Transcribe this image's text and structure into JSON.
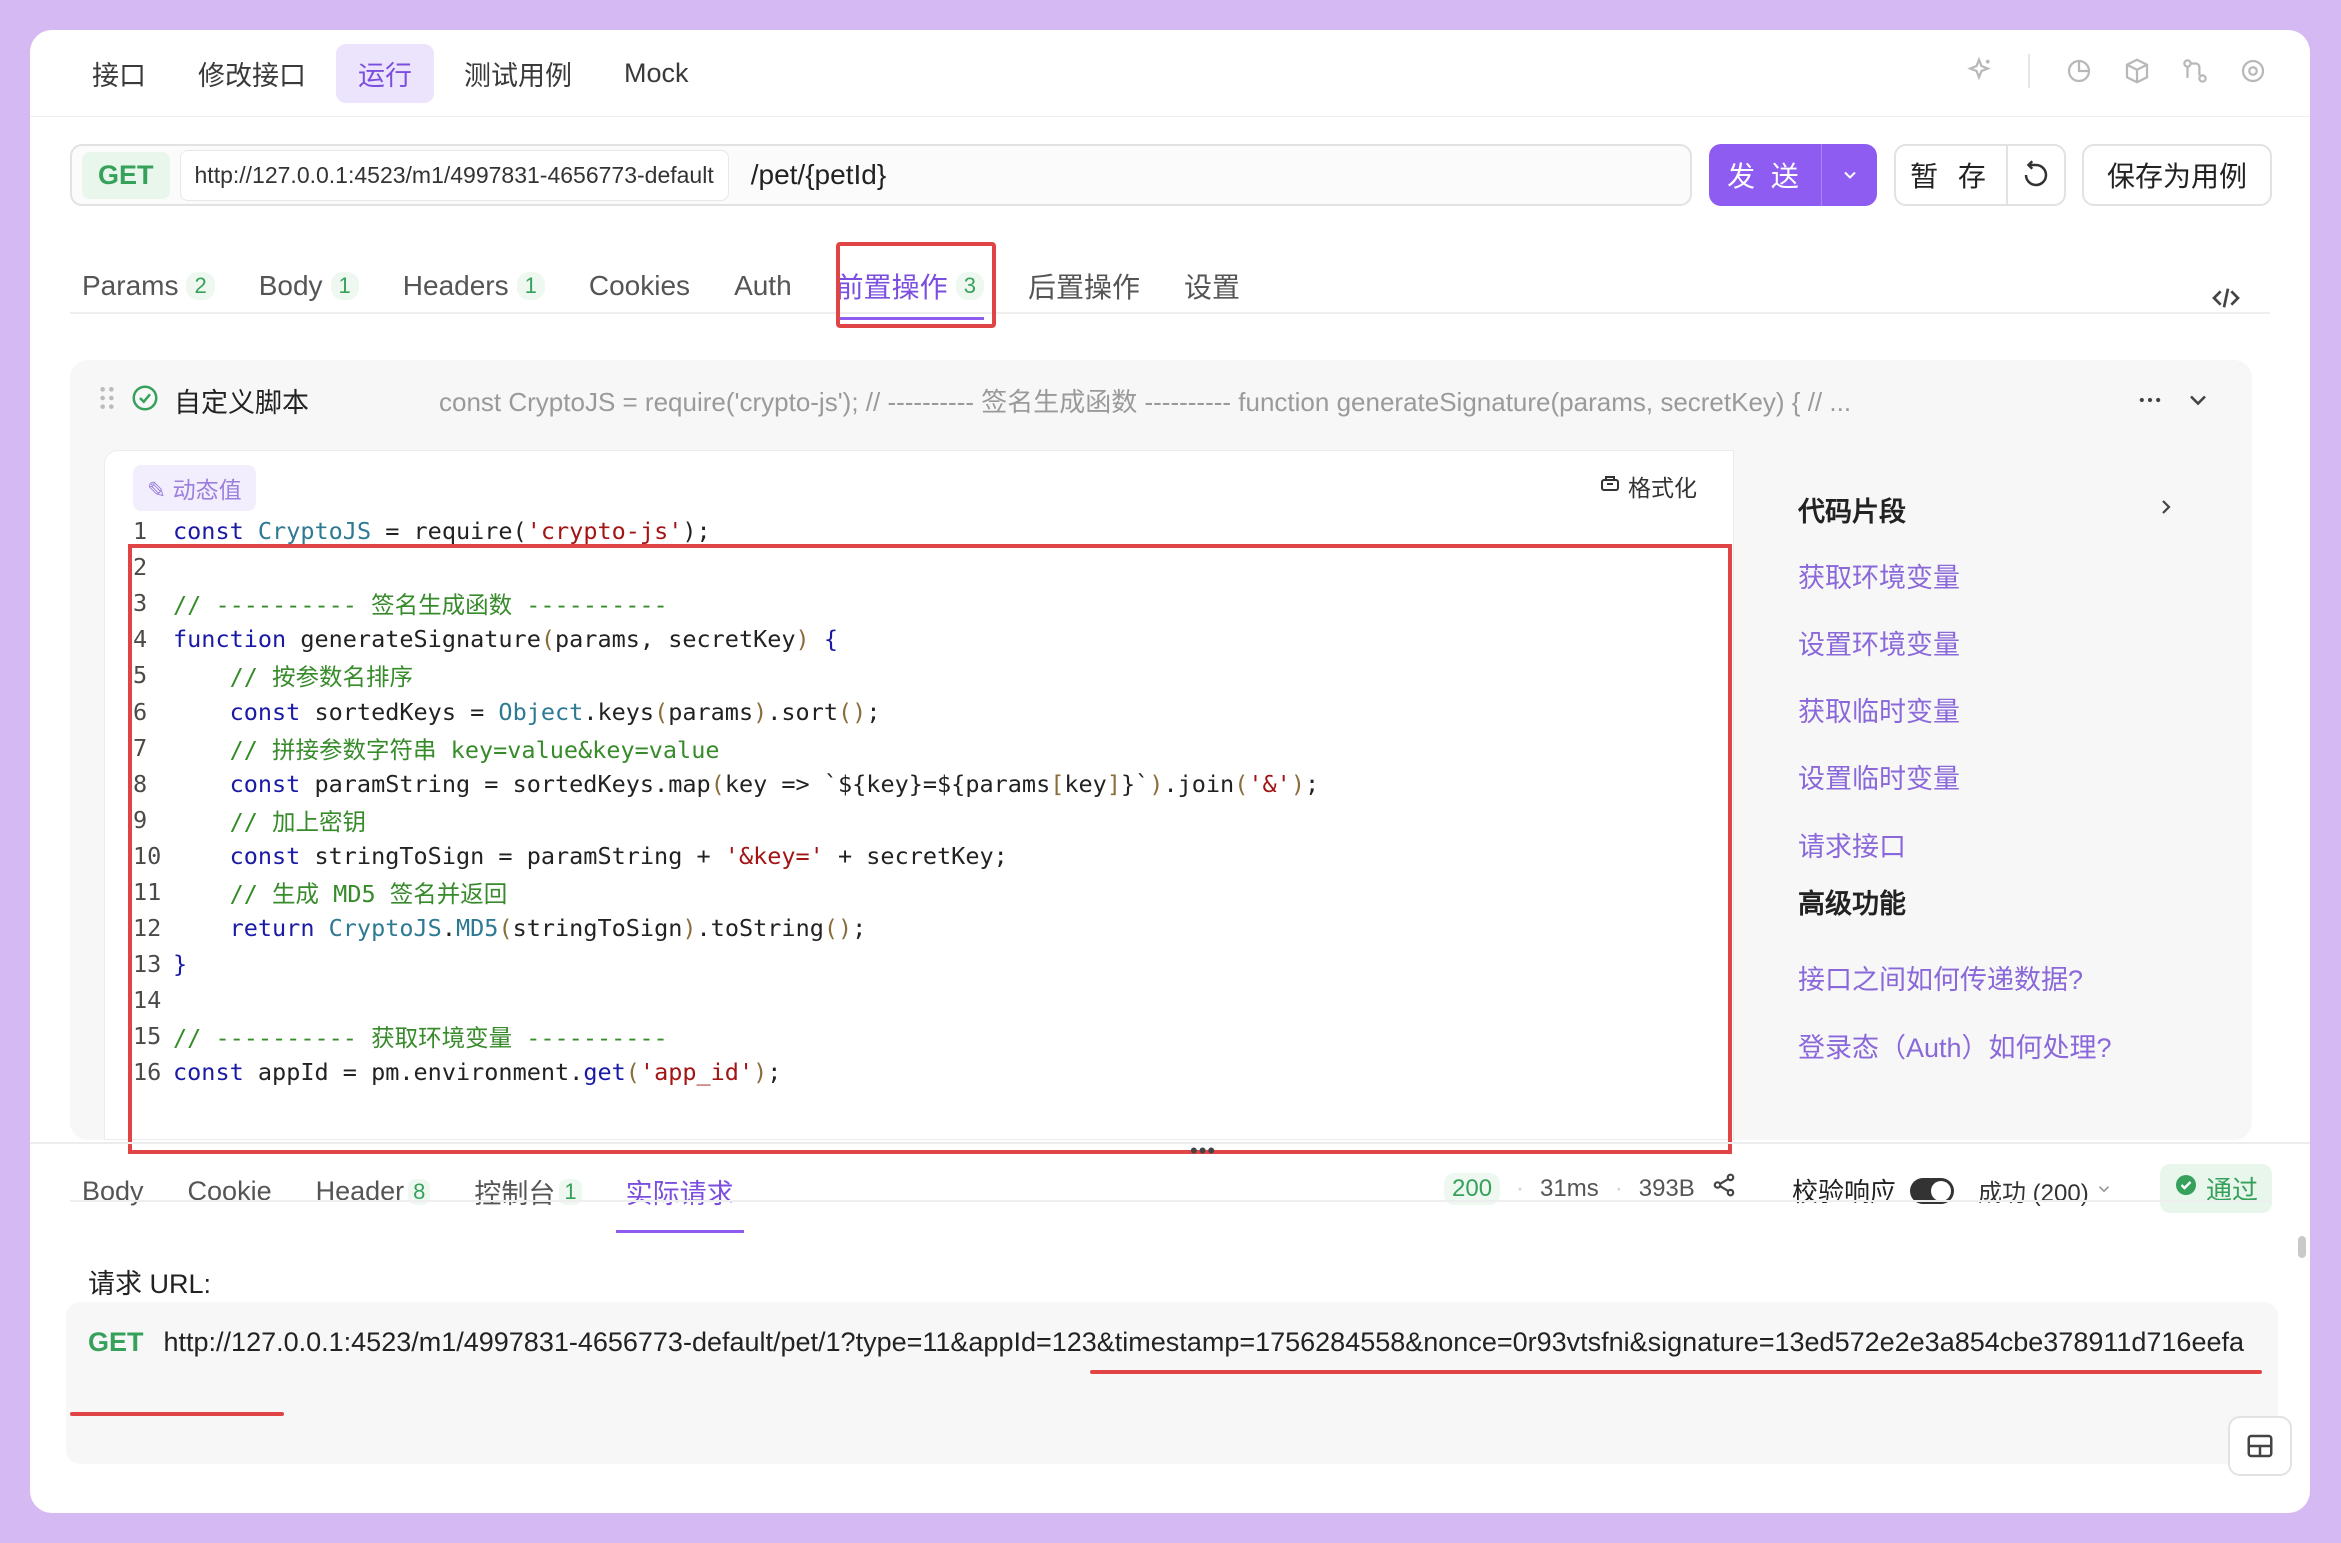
{
  "top_tabs": [
    "接口",
    "修改接口",
    "运行",
    "测试用例",
    "Mock"
  ],
  "top_icons": [
    "sparkle-icon",
    "chart-icon",
    "cube-icon",
    "branch-icon",
    "settings-icon"
  ],
  "request": {
    "method": "GET",
    "base_url": "http://127.0.0.1:4523/m1/4997831-4656773-default",
    "path": "/pet/{petId}",
    "send_label": "发 送",
    "save_label": "暂 存",
    "save_case_label": "保存为用例"
  },
  "req_tabs": [
    {
      "label": "Params",
      "count": "2"
    },
    {
      "label": "Body",
      "count": "1"
    },
    {
      "label": "Headers",
      "count": "1"
    },
    {
      "label": "Cookies",
      "count": ""
    },
    {
      "label": "Auth",
      "count": ""
    },
    {
      "label": "前置操作",
      "count": "3"
    },
    {
      "label": "后置操作",
      "count": ""
    },
    {
      "label": "设置",
      "count": ""
    }
  ],
  "script": {
    "title": "自定义脚本",
    "preview": "const CryptoJS = require('crypto-js'); // ---------- 签名生成函数 ---------- function generateSignature(params, secretKey) { // ...",
    "dynamic_label": "动态值",
    "format_label": "格式化",
    "code_lines": [
      "1",
      "2",
      "3",
      "4",
      "5",
      "6",
      "7",
      "8",
      "9",
      "10",
      "11",
      "12",
      "13",
      "14",
      "15",
      "16"
    ]
  },
  "snippets": {
    "title": "代码片段",
    "links": [
      "获取环境变量",
      "设置环境变量",
      "获取临时变量",
      "设置临时变量",
      "请求接口"
    ],
    "advanced_title": "高级功能",
    "advanced_links": [
      "接口之间如何传递数据?",
      "登录态（Auth）如何处理?"
    ]
  },
  "response": {
    "tabs": [
      {
        "label": "Body",
        "count": ""
      },
      {
        "label": "Cookie",
        "count": ""
      },
      {
        "label": "Header",
        "count": "8"
      },
      {
        "label": "控制台",
        "count": "1"
      },
      {
        "label": "实际请求",
        "count": ""
      }
    ],
    "status": "200",
    "time": "31ms",
    "size": "393B",
    "validate_label": "校验响应",
    "status_select": "成功 (200)",
    "pass_label": "通过",
    "request_url_label": "请求 URL:",
    "request_method": "GET",
    "request_url": "http://127.0.0.1:4523/m1/4997831-4656773-default/pet/1?type=11&appId=123&timestamp=1756284558&nonce=0r93vtsfni&signature=13ed572e2e3a854cbe378911d716eefa"
  },
  "colors": {
    "accent": "#8e5cf1",
    "success": "#36a15a",
    "highlight": "#e14444",
    "background": "#d4b9f2"
  }
}
